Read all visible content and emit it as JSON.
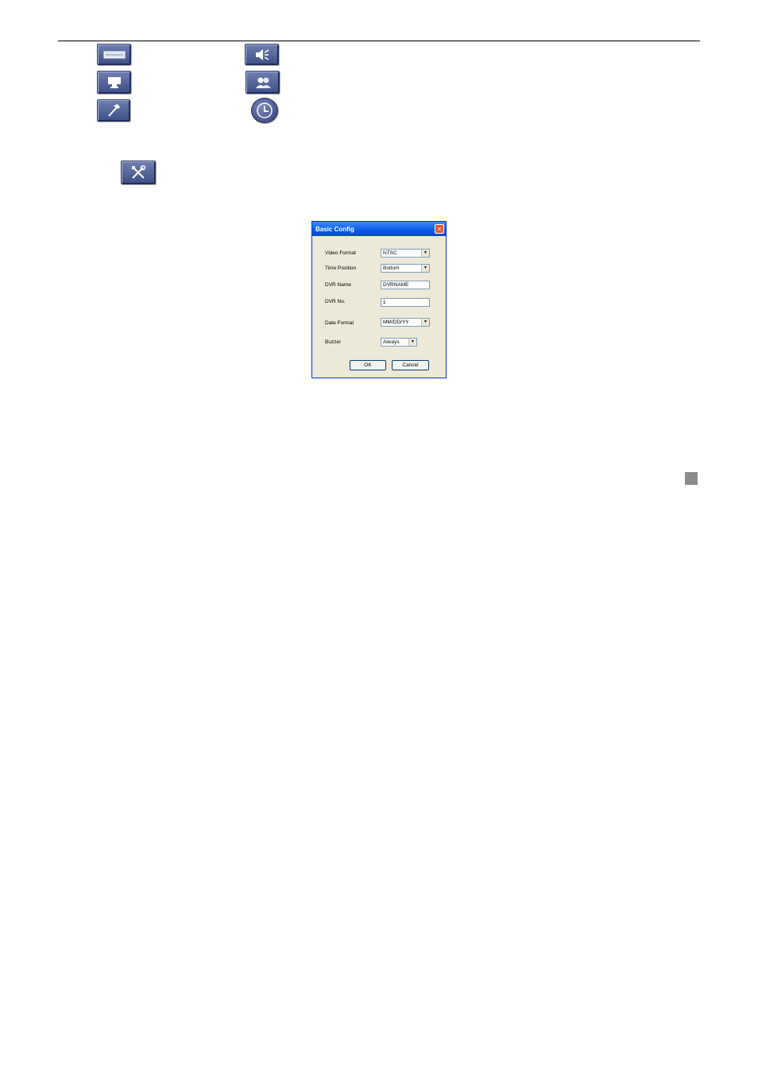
{
  "toolbar_icons": [
    "video-strip-icon",
    "speaker-icon",
    "monitor-icon",
    "users-icon",
    "hammer-icon",
    "clock-icon",
    "tools-icon"
  ],
  "dialog": {
    "title": "Basic Config",
    "fields": {
      "video_format": {
        "label": "Video Format",
        "value": "NTSC"
      },
      "time_position": {
        "label": "Time Position",
        "value": "Bottom"
      },
      "dvr_name": {
        "label": "DVR Name",
        "value": "DVRNAME"
      },
      "dvr_no": {
        "label": "DVR No.",
        "value": "1"
      },
      "date_format": {
        "label": "Date Format",
        "value": "MM/DD/YY"
      },
      "buzzer": {
        "label": "Buzzer",
        "value": "Always"
      }
    },
    "ok_label": "OK",
    "cancel_label": "Cancel"
  }
}
